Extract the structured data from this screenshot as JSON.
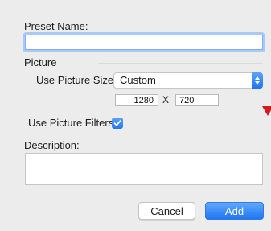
{
  "preset_name": {
    "label": "Preset Name:",
    "value": ""
  },
  "picture": {
    "heading": "Picture",
    "size_label": "Use Picture Size:",
    "size_selected": "Custom",
    "width": "1280",
    "separator": "X",
    "height": "720",
    "filters_label": "Use Picture Filters:",
    "filters_checked": true
  },
  "description": {
    "heading": "Description:",
    "value": ""
  },
  "buttons": {
    "cancel": "Cancel",
    "add": "Add"
  },
  "colors": {
    "accent": "#1f76f1",
    "marker": "#d31b1b"
  }
}
